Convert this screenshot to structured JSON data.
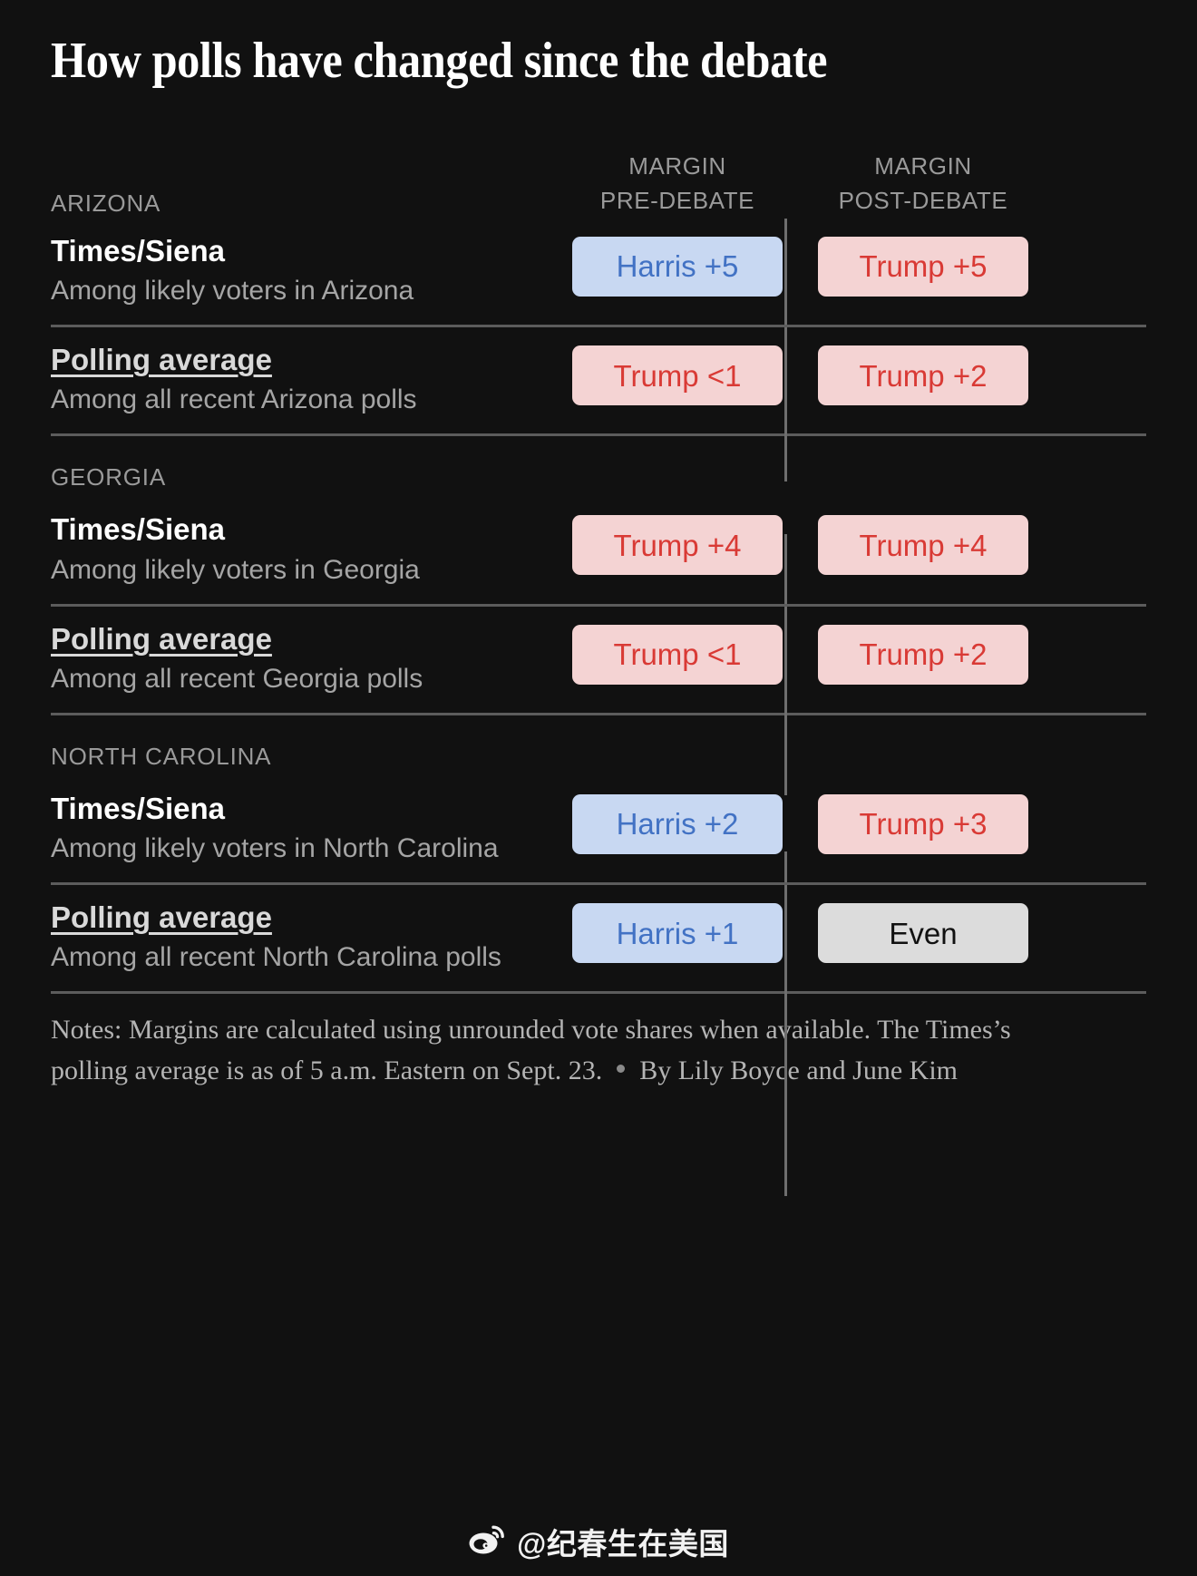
{
  "headline": "How polls have changed since the debate",
  "columns": {
    "pre": "MARGIN\nPRE-DEBATE",
    "pre_line1": "MARGIN",
    "pre_line2": "PRE-DEBATE",
    "post_line1": "MARGIN",
    "post_line2": "POST-DEBATE"
  },
  "colors": {
    "background": "#111111",
    "harris_pill_bg": "#c8d8f2",
    "harris_pill_text": "#4272c4",
    "trump_pill_bg": "#f4d3d3",
    "trump_pill_text": "#d93a35",
    "even_pill_bg": "#dcdcdc",
    "even_pill_text": "#111111",
    "muted_text": "#9a9a9a",
    "rule": "#5c5c5c"
  },
  "sections": [
    {
      "state": "ARIZONA",
      "rows": [
        {
          "pollster": "Times/Siena",
          "is_link": false,
          "sub": "Among likely voters in Arizona",
          "pre": {
            "label": "Harris +5",
            "party": "harris"
          },
          "post": {
            "label": "Trump +5",
            "party": "trump"
          }
        },
        {
          "pollster": "Polling average",
          "is_link": true,
          "sub": "Among all recent Arizona polls",
          "pre": {
            "label": "Trump <1",
            "party": "trump"
          },
          "post": {
            "label": "Trump +2",
            "party": "trump"
          }
        }
      ]
    },
    {
      "state": "GEORGIA",
      "rows": [
        {
          "pollster": "Times/Siena",
          "is_link": false,
          "sub": "Among likely voters in Georgia",
          "pre": {
            "label": "Trump +4",
            "party": "trump"
          },
          "post": {
            "label": "Trump +4",
            "party": "trump"
          }
        },
        {
          "pollster": "Polling average",
          "is_link": true,
          "sub": "Among all recent Georgia polls",
          "pre": {
            "label": "Trump <1",
            "party": "trump"
          },
          "post": {
            "label": "Trump +2",
            "party": "trump"
          }
        }
      ]
    },
    {
      "state": "NORTH CAROLINA",
      "rows": [
        {
          "pollster": "Times/Siena",
          "is_link": false,
          "sub": "Among likely voters in North Carolina",
          "pre": {
            "label": "Harris +2",
            "party": "harris"
          },
          "post": {
            "label": "Trump +3",
            "party": "trump"
          }
        },
        {
          "pollster": "Polling average",
          "is_link": true,
          "sub": "Among all recent North Carolina polls",
          "pre": {
            "label": "Harris +1",
            "party": "harris"
          },
          "post": {
            "label": "Even",
            "party": "even"
          }
        }
      ]
    }
  ],
  "notes": {
    "body": "Notes: Margins are calculated using unrounded vote shares when available. The Times’s polling average is as of 5 a.m. Eastern on Sept. 23.",
    "byline": "By Lily Boyce and June Kim"
  },
  "watermark": {
    "icon": "weibo-icon",
    "handle": "@纪春生在美国"
  }
}
